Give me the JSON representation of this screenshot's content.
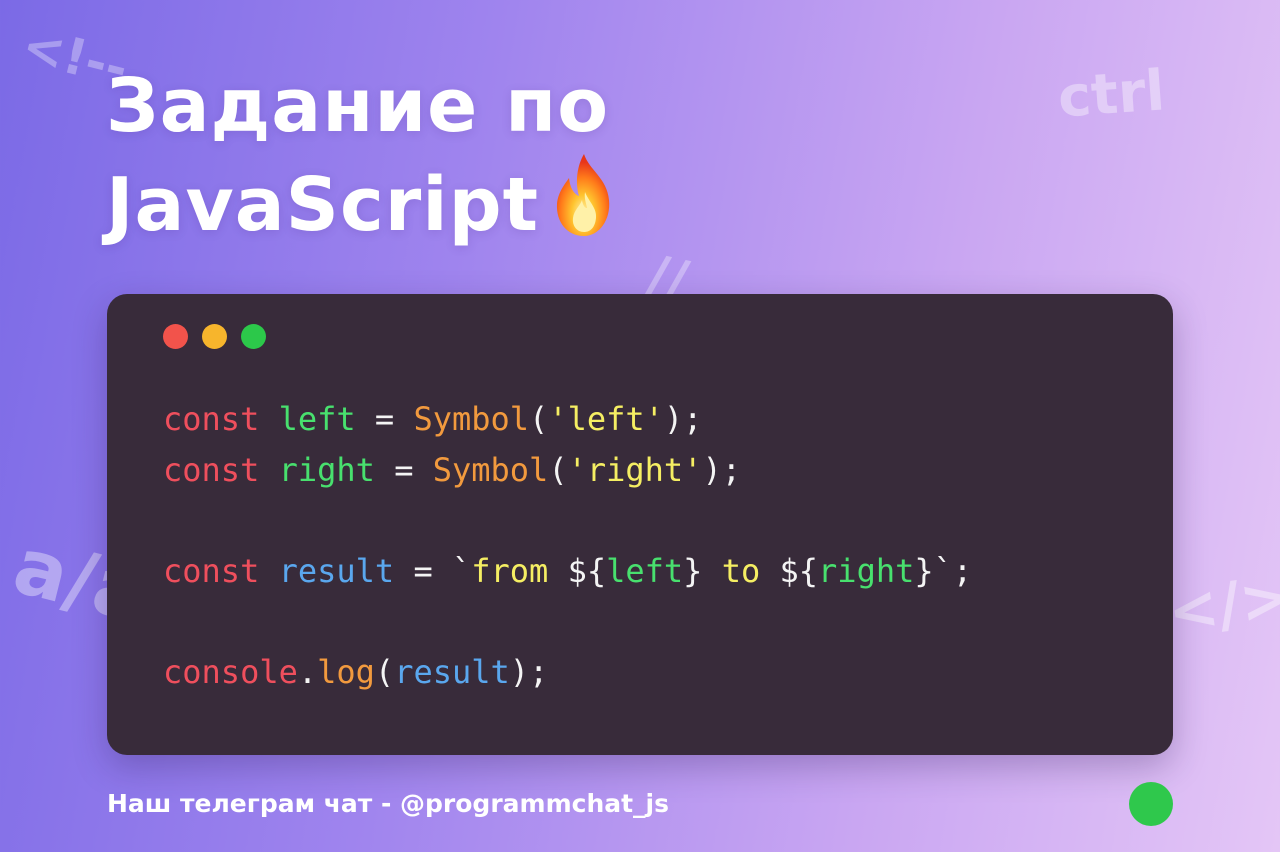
{
  "background_glyphs": {
    "comment": "<!--",
    "ctrl": "ctrl",
    "slashes": "//",
    "a": "a/a",
    "close_tag": "</>"
  },
  "title": {
    "line1": "Задание по",
    "line2": "JavaScript"
  },
  "title_icon": "fire-emoji",
  "window_controls": {
    "red": "#f2534b",
    "yellow": "#f7b52c",
    "green": "#2cc84a"
  },
  "code": {
    "line1": {
      "kw": "const",
      "name": "left",
      "eq": "=",
      "fn": "Symbol",
      "open": "(",
      "arg": "'left'",
      "close": ");"
    },
    "line2": {
      "kw": "const",
      "name": "right",
      "eq": "=",
      "fn": "Symbol",
      "open": "(",
      "arg": "'right'",
      "close": ");"
    },
    "line3": {
      "kw": "const",
      "name": "result",
      "eq": "=",
      "tick_open": "`",
      "from": "from",
      "interp1_open": "${",
      "interp1_var": "left",
      "interp1_close": "}",
      "to": "to",
      "interp2_open": "${",
      "interp2_var": "right",
      "interp2_close": "}",
      "tick_close": "`;"
    },
    "line4": {
      "obj": "console",
      "dot": ".",
      "method": "log",
      "open": "(",
      "arg": "result",
      "close": ");"
    }
  },
  "footer": {
    "text": "Наш телеграм чат - @programmchat_js",
    "status_color": "#2fc84c"
  },
  "colors": {
    "keyword": "#ef4f5d",
    "variable": "#48e06e",
    "result_var": "#5aa7ee",
    "function": "#f29a3e",
    "string": "#f5ee63",
    "code_bg": "#382b3a"
  }
}
